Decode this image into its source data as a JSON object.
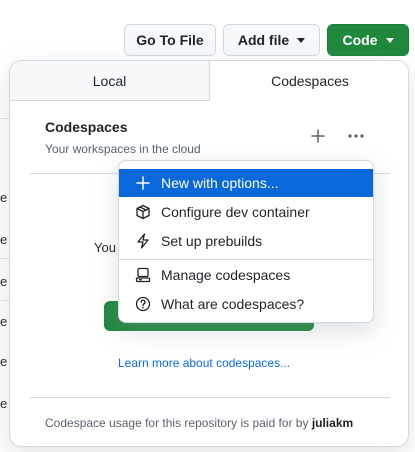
{
  "toolbar": {
    "goto_label": "Go To File",
    "add_label": "Add file",
    "code_label": "Code"
  },
  "background": {
    "fragments": [
      "e",
      "e",
      "e",
      "e",
      "e",
      "e"
    ]
  },
  "tabs": {
    "local": "Local",
    "codespaces": "Codespaces"
  },
  "codespaces": {
    "title": "Codespaces",
    "subtitle": "Your workspaces in the cloud",
    "obscured_text": "You",
    "learn_link": "Learn more about codespaces...",
    "footer_text": "Codespace usage for this repository is paid for by ",
    "footer_user": "juliakm"
  },
  "menu": {
    "items": [
      {
        "label": "New with options...",
        "icon": "plus-icon",
        "active": true
      },
      {
        "label": "Configure dev container",
        "icon": "container-icon"
      },
      {
        "label": "Set up prebuilds",
        "icon": "zap-icon"
      },
      {
        "label": "Manage codespaces",
        "icon": "codespaces-icon"
      },
      {
        "label": "What are codespaces?",
        "icon": "question-icon"
      }
    ]
  },
  "colors": {
    "accent_blue": "#0969da",
    "code_green": "#1f883d"
  }
}
